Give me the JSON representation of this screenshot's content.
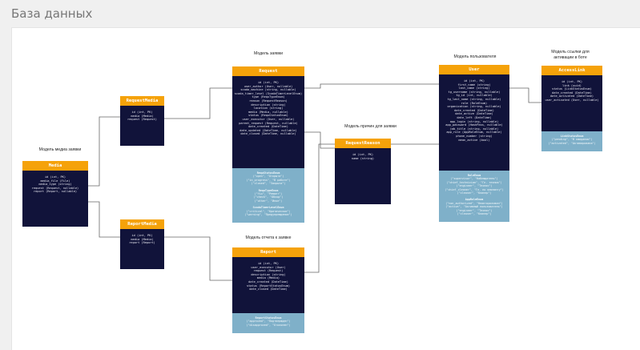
{
  "page": {
    "title": "База данных"
  },
  "captions": {
    "media": "Модель медиа заявки",
    "request": "Модель заявки",
    "reason": "Модель причин для заявки",
    "report": "Модель отчета к заявке",
    "user": "Модель пользователя",
    "access": "Модель ссылки для активации в боте"
  },
  "entities": {
    "media": {
      "title": "Media",
      "fields": [
        "id (int, PK)",
        "media_file (File)",
        "media_type (string)",
        "request (Request, nullable)",
        "report (Report, nullable)"
      ]
    },
    "request_media": {
      "title": "RequestMedia",
      "fields": [
        "id (int, PK)",
        "media (Media)",
        "request (Request)"
      ]
    },
    "report_media": {
      "title": "ReportMedia",
      "fields": [
        "id (int, PK)",
        "media (Media)",
        "report (Report)"
      ]
    },
    "request": {
      "title": "Request",
      "fields": [
        "id (int, PK)",
        "user_author (User, nullable)",
        "scada_machine (string, nullable)",
        "scada_timer_level (ScadaTimerLevelEnum)",
        "type (RequTypeEnum)",
        "reason (RequestReason)",
        "description (string)",
        "location (string)",
        "media (Media, nullable)",
        "status (RequStatusEnum)",
        "user_executor (User, nullable)",
        "parent_request (Request, nullable)",
        "date_created (DateTime)",
        "date_updated (DateTime, nullable)",
        "date_closed (DateTime, nullable)"
      ],
      "enums": [
        {
          "name": "RequStatusEnum",
          "values": [
            "(\"open\", \"Открыта\")",
            "(\"in_progress\", \"В работе\")",
            "(\"closed\", \"Закрыта\")"
          ]
        },
        {
          "name": "RequTypeEnum",
          "values": [
            "(\"fix\", \"Ремонт\")",
            "(\"check\", \"Обход\")",
            "(\"other\", \"Иное\")"
          ]
        },
        {
          "name": "ScadaTimerLevelEnum",
          "values": [
            "(\"critical\", \"Критическое\")",
            "(\"warning\", \"Предупреждение\")"
          ]
        }
      ]
    },
    "request_reason": {
      "title": "RequestReason",
      "fields": [
        "id (int, PK)",
        "name (string)"
      ]
    },
    "report": {
      "title": "Report",
      "fields": [
        "id (int, PK)",
        "user_executor (User)",
        "request (Request)",
        "description (string)",
        "media (Media)",
        "date_created (DateTime)",
        "status (ReportStatusEnum)",
        "date_closed (DateTime)"
      ],
      "enums": [
        {
          "name": "ReportStatusEnum",
          "values": [
            "(\"approved\", \"Подтвержден\")",
            "(\"disapproved\", \"Отклонен\")"
          ]
        }
      ]
    },
    "user": {
      "title": "User",
      "fields": [
        "id (int, PK)",
        "first_name (string)",
        "last_name (string)",
        "tg_username (string, nullable)",
        "tg_id (int, nullable)",
        "tg_last_name (string, nullable)",
        "role (RoleEnum)",
        "organization (string, nullable)",
        "date_created (DateTime)",
        "date_active (DateTime)",
        "date_left (DateTime)",
        "app_login (string, nullable)",
        "app_password (HashPass, nullable)",
        "job_title (string, nullable)",
        "app_role (AppRoleEnum, nullable)",
        "phone_number (string)",
        "mean_active (bool)"
      ],
      "enums": [
        {
          "name": "RoleEnum",
          "values": [
            "(\"supervisor\", \"Наблюдатель\")",
            "(\"chief_technician\", \"Гл. техник\")",
            "(\"engineer\", \"Техник\")",
            "(\"chief_cleaner\", \"Гл. по клинингу\")",
            "(\"cleaner\", \"Клинер\")"
          ]
        },
        {
          "name": "AppRoleEnum",
          "values": [
            "(\"non_authorized\", \"Неавторизован\")",
            "(\"active\", \"Активный пользователь\")",
            "(\"engineer\", \"Техник\")",
            "(\"cleaner\", \"Клинер\")"
          ]
        }
      ]
    },
    "access_link": {
      "title": "AccessLink",
      "fields": [
        "id (int, PK)",
        "link (uuid)",
        "status (LinkStatusEnum)",
        "date_created (DateTime)",
        "date_activated (DateTime)",
        "user_activated (User, nullable)"
      ],
      "enums": [
        {
          "name": "LinkStatusEnum",
          "values": [
            "(\"pending\", \"В ожидании\")",
            "(\"activated\", \"Активирована\")"
          ]
        }
      ]
    }
  }
}
